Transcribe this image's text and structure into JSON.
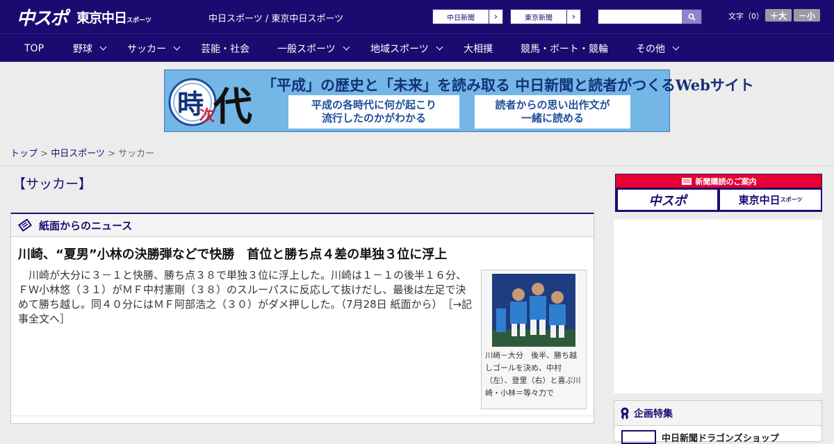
{
  "header": {
    "logo_chuspo": "中スポ",
    "logo_tokyo": "東京中日",
    "logo_tokyo_sub": "スポーツ",
    "site_name": "中日スポーツ / 東京中日スポーツ",
    "link_chunichi": "中日新聞",
    "link_tokyo": "東京新聞",
    "search_placeholder": "",
    "font_label": "文字（0）",
    "font_larger": "＋大",
    "font_smaller": "－小"
  },
  "nav": [
    {
      "label": "TOP",
      "dropdown": false
    },
    {
      "label": "野球",
      "dropdown": true
    },
    {
      "label": "サッカー",
      "dropdown": true
    },
    {
      "label": "芸能・社会",
      "dropdown": false
    },
    {
      "label": "一般スポーツ",
      "dropdown": true
    },
    {
      "label": "地域スポーツ",
      "dropdown": true
    },
    {
      "label": "大相撲",
      "dropdown": false
    },
    {
      "label": "競馬・ボート・競輪",
      "dropdown": false
    },
    {
      "label": "その他",
      "dropdown": true
    }
  ],
  "banner": {
    "kanji_ji": "時",
    "kanji_tsugi": "次",
    "kanji_dai": "代",
    "headline": "「平成」の歴史と「未来」を読み取る 中日新聞と読者がつくるWebサイト",
    "box1": "平成の各時代に何が起こり\n流行したのかがわかる",
    "box2": "読者からの思い出作文が\n一緒に読める"
  },
  "breadcrumb": {
    "top": "トップ",
    "sep": " > ",
    "chunichi": "中日スポーツ",
    "current": "サッカー"
  },
  "page_title": "【サッカー】",
  "news_panel": {
    "title": "紙面からのニュース",
    "article_title": "川崎、“夏男”小林の決勝弾などで快勝　首位と勝ち点４差の単独３位に浮上",
    "article_body": "川崎が大分に３－１と快勝、勝ち点３８で単独３位に浮上した。川崎は１－１の後半１６分、ＦＷ小林悠（３１）がＭＦ中村憲剛（３８）のスルーパスに反応して抜けだし、最後は左足で決めて勝ち越し。同４０分にはＭＦ阿部浩之（３０）がダメ押しした。（7月28日 紙面から）",
    "more_link": "［→記事全文へ］",
    "photo_caption": "川崎－大分　後半、勝ち越しゴールを決め、中村（左）、登里（右）と喜ぶ川崎・小林＝等々力で"
  },
  "sidebar": {
    "subscribe_label": "新聞購読のご案内",
    "subscribe_chuspo": "中スポ",
    "subscribe_tokyo": "東京中日",
    "subscribe_tokyo_sub": "スポーツ",
    "feature_title": "企画特集",
    "feature_item": "中日新聞ドラゴンズショップ"
  },
  "colors": {
    "brand_navy": "#1b0b70",
    "subscribe_red": "#e60033"
  }
}
